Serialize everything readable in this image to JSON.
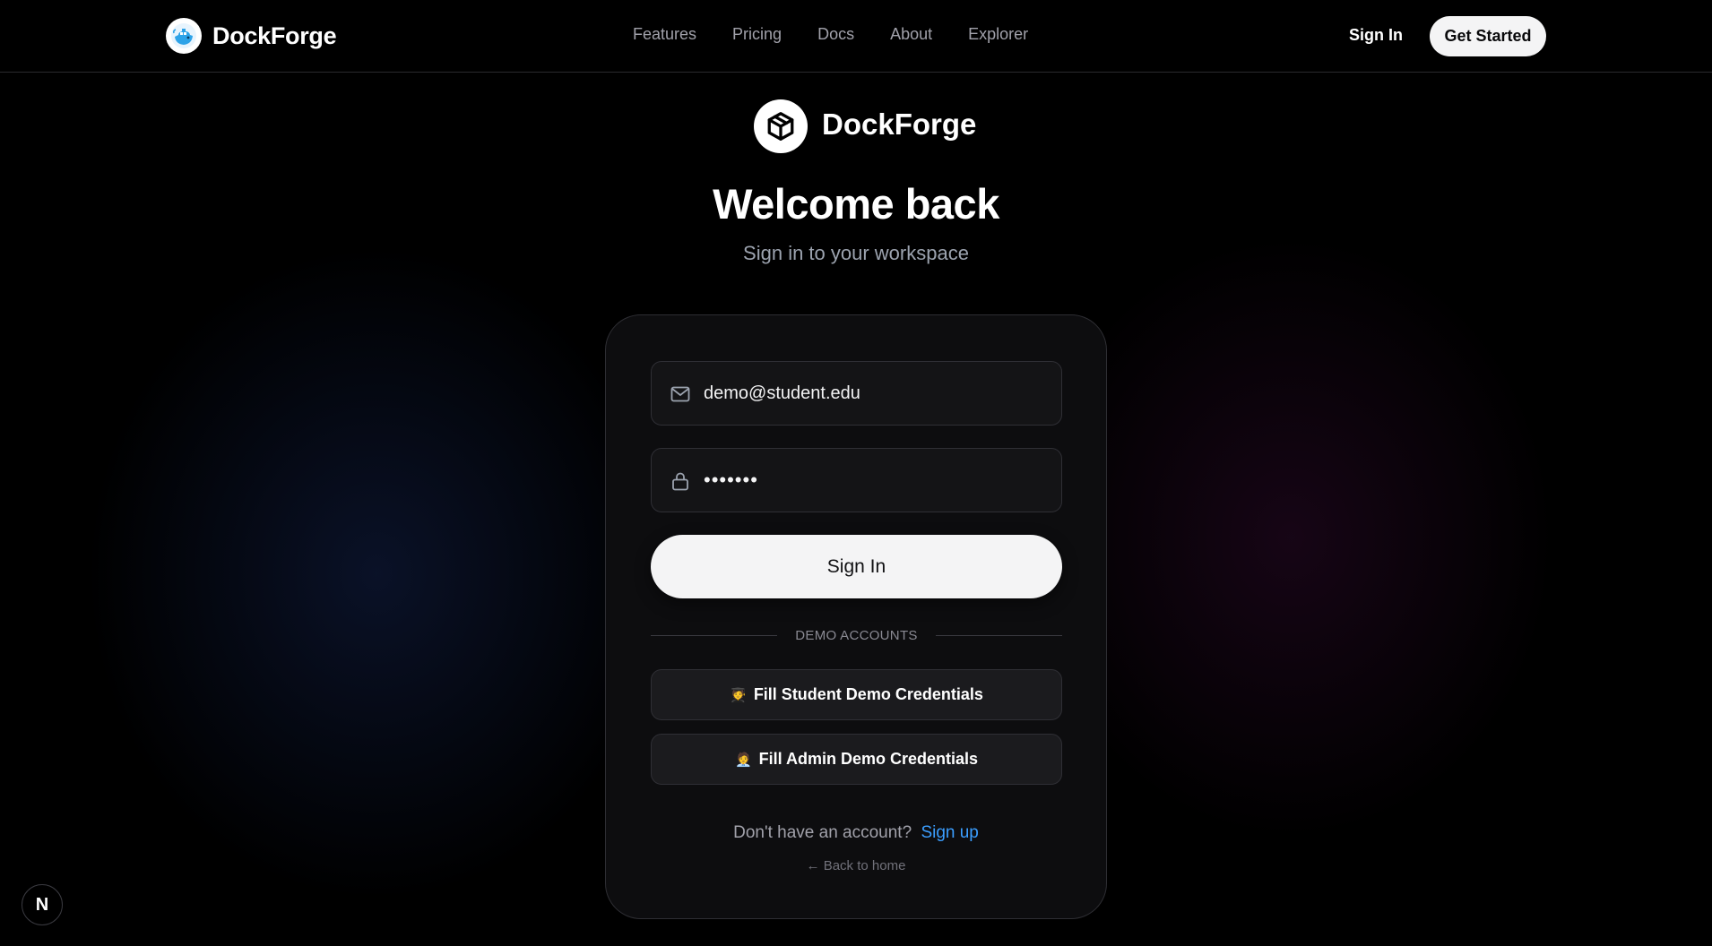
{
  "nav": {
    "brand": "DockForge",
    "links": [
      "Features",
      "Pricing",
      "Docs",
      "About",
      "Explorer"
    ],
    "sign_in": "Sign In",
    "get_started": "Get Started"
  },
  "header": {
    "brand": "DockForge",
    "title": "Welcome back",
    "subtitle": "Sign in to your workspace"
  },
  "form": {
    "email_value": "demo@student.edu",
    "password_value": "•••••••",
    "submit_label": "Sign In",
    "divider_label": "DEMO ACCOUNTS",
    "student_emoji": "🧑‍🎓",
    "student_label": "Fill Student Demo Credentials",
    "admin_emoji": "🧑‍💼",
    "admin_label": "Fill Admin Demo Credentials",
    "no_account_text": "Don't have an account?",
    "signup_label": "Sign up",
    "back_home": "← Back to home"
  },
  "badge": {
    "letter": "N"
  },
  "icons": {
    "brand_logo": "whale-icon",
    "hero_logo": "cube-icon",
    "email": "mail-icon",
    "password": "lock-icon"
  }
}
